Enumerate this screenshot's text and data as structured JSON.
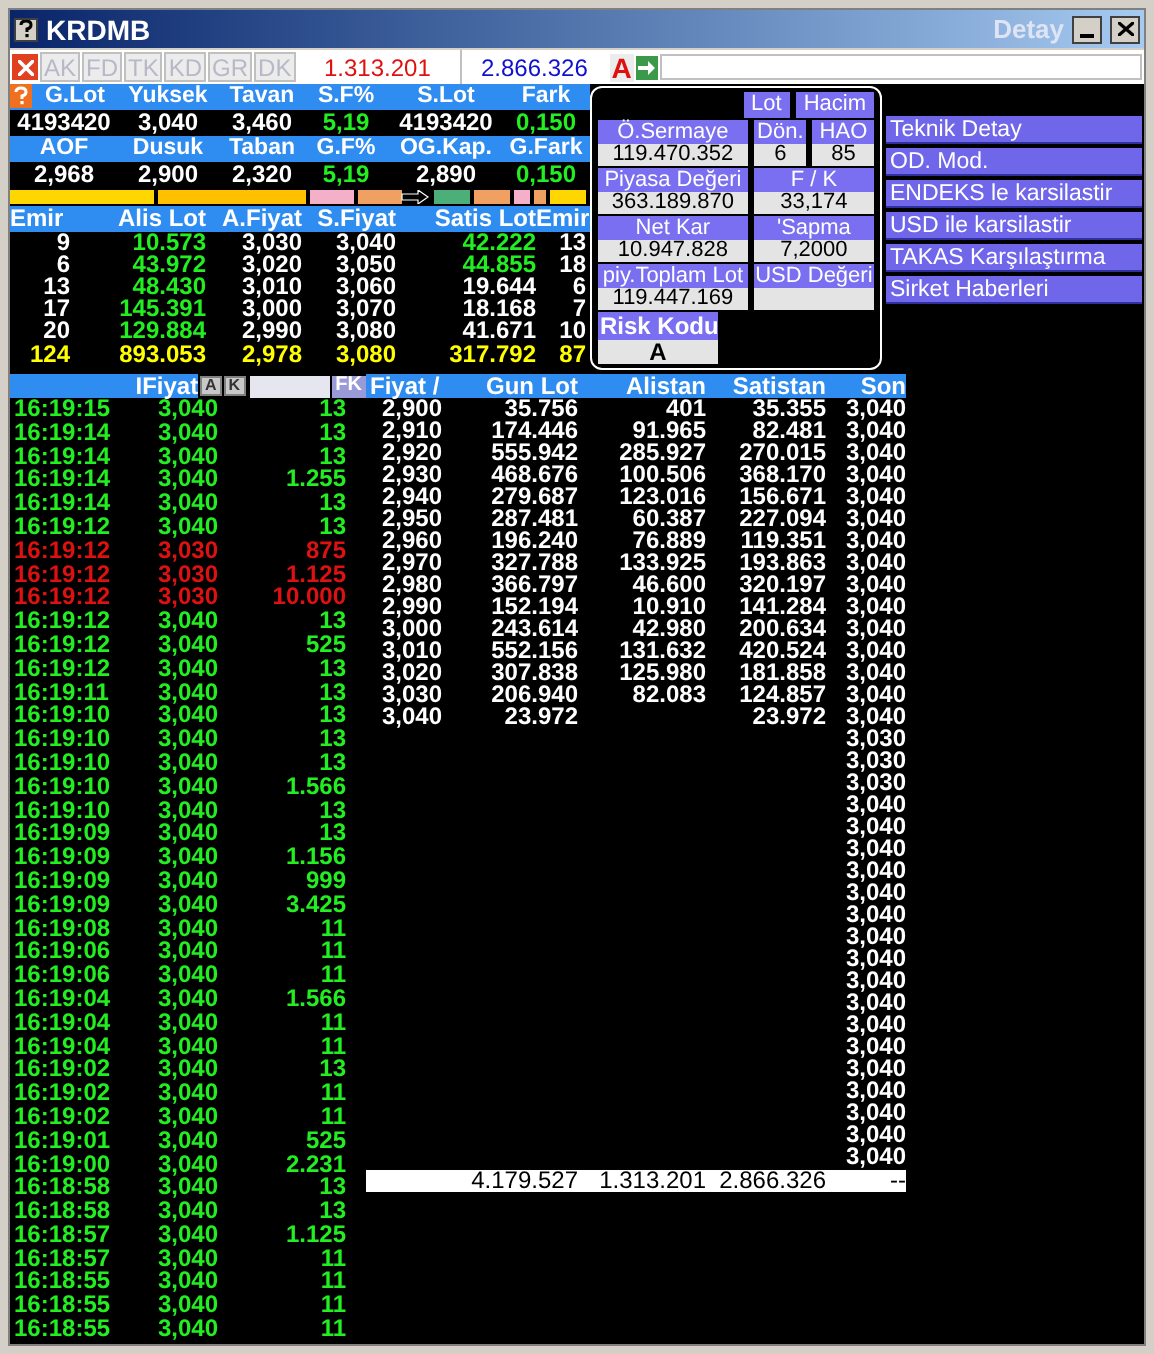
{
  "window": {
    "title": "KRDMB",
    "title_right": "Detay"
  },
  "toolbar": {
    "buttons": [
      "AK",
      "FD",
      "TK",
      "KD",
      "GR",
      "DK"
    ],
    "buy_total": "1.313.201",
    "sell_total": "2.866.326",
    "grade": "A"
  },
  "summary": [
    {
      "headers": [
        "G.Lot",
        "Yuksek",
        "Tavan",
        "S.F%",
        "S.Lot",
        "Fark"
      ],
      "values": [
        {
          "text": "4193420",
          "up": false
        },
        {
          "text": "3,040",
          "up": false
        },
        {
          "text": "3,460",
          "up": false
        },
        {
          "text": "5,19",
          "up": true
        },
        {
          "text": "4193420",
          "up": false
        },
        {
          "text": "0,150",
          "up": true
        }
      ]
    },
    {
      "headers": [
        "AOF",
        "Dusuk",
        "Taban",
        "G.F%",
        "OG.Kap.",
        "G.Fark"
      ],
      "values": [
        {
          "text": "2,968",
          "up": false
        },
        {
          "text": "2,900",
          "up": false
        },
        {
          "text": "2,320",
          "up": false
        },
        {
          "text": "5,19",
          "up": true
        },
        {
          "text": "2,890",
          "up": false
        },
        {
          "text": "0,150",
          "up": true
        }
      ]
    }
  ],
  "order_book": {
    "columns": [
      "Emir",
      "Alis Lot",
      "A.Fiyat",
      "S.Fiyat",
      "Satis Lot",
      "Emir"
    ],
    "rows": [
      {
        "cells": [
          "9",
          "10.573",
          "3,030",
          "3,040",
          "42.222",
          "13"
        ],
        "bid_up": true,
        "ask_up": true
      },
      {
        "cells": [
          "6",
          "43.972",
          "3,020",
          "3,050",
          "44.855",
          "18"
        ],
        "bid_up": true,
        "ask_up": true
      },
      {
        "cells": [
          "13",
          "48.430",
          "3,010",
          "3,060",
          "19.644",
          "6"
        ],
        "bid_up": true,
        "ask_up": false
      },
      {
        "cells": [
          "17",
          "145.391",
          "3,000",
          "3,070",
          "18.168",
          "7"
        ],
        "bid_up": true,
        "ask_up": false
      },
      {
        "cells": [
          "20",
          "129.884",
          "2,990",
          "3,080",
          "41.671",
          "10"
        ],
        "bid_up": true,
        "ask_up": false
      }
    ],
    "totals": [
      "124",
      "893.053",
      "2,978",
      "3,080",
      "317.792",
      "87"
    ]
  },
  "detail": {
    "toggles": [
      "Lot",
      "Hacim"
    ],
    "fields": [
      {
        "label": "Ö.Sermaye",
        "value": "119.470.352"
      },
      {
        "label": "Dön.",
        "value": "6"
      },
      {
        "label": "HAO",
        "value": "85"
      },
      {
        "label": "Piyasa Değeri",
        "value": "363.189.870"
      },
      {
        "label": "F / K",
        "value": "33,174"
      },
      {
        "label": "Net Kar",
        "value": "10.947.828"
      },
      {
        "label": "'Sapma",
        "value": "7,2000"
      },
      {
        "label": "piy.Toplam Lot",
        "value": "119.447.169"
      },
      {
        "label": "USD Değeri"
      }
    ],
    "risk_label": "Risk Kodu",
    "risk_value": "A"
  },
  "links": [
    "Teknik Detay",
    "OD. Mod.",
    "ENDEKS le karsilastir",
    "USD ile karsilastir",
    "TAKAS Karşılaştırma",
    "Sirket Haberleri"
  ],
  "trades": {
    "header": "IFiyat",
    "buttons": [
      "A",
      "K"
    ],
    "filter_button": "FK",
    "rows": [
      {
        "time": "16:19:15",
        "price": "3,040",
        "lot": "13",
        "sell": false
      },
      {
        "time": "16:19:14",
        "price": "3,040",
        "lot": "13",
        "sell": false
      },
      {
        "time": "16:19:14",
        "price": "3,040",
        "lot": "13",
        "sell": false
      },
      {
        "time": "16:19:14",
        "price": "3,040",
        "lot": "1.255",
        "sell": false
      },
      {
        "time": "16:19:14",
        "price": "3,040",
        "lot": "13",
        "sell": false
      },
      {
        "time": "16:19:12",
        "price": "3,040",
        "lot": "13",
        "sell": false
      },
      {
        "time": "16:19:12",
        "price": "3,030",
        "lot": "875",
        "sell": true
      },
      {
        "time": "16:19:12",
        "price": "3,030",
        "lot": "1.125",
        "sell": true
      },
      {
        "time": "16:19:12",
        "price": "3,030",
        "lot": "10.000",
        "sell": true
      },
      {
        "time": "16:19:12",
        "price": "3,040",
        "lot": "13",
        "sell": false
      },
      {
        "time": "16:19:12",
        "price": "3,040",
        "lot": "525",
        "sell": false
      },
      {
        "time": "16:19:12",
        "price": "3,040",
        "lot": "13",
        "sell": false
      },
      {
        "time": "16:19:11",
        "price": "3,040",
        "lot": "13",
        "sell": false
      },
      {
        "time": "16:19:10",
        "price": "3,040",
        "lot": "13",
        "sell": false
      },
      {
        "time": "16:19:10",
        "price": "3,040",
        "lot": "13",
        "sell": false
      },
      {
        "time": "16:19:10",
        "price": "3,040",
        "lot": "13",
        "sell": false
      },
      {
        "time": "16:19:10",
        "price": "3,040",
        "lot": "1.566",
        "sell": false
      },
      {
        "time": "16:19:10",
        "price": "3,040",
        "lot": "13",
        "sell": false
      },
      {
        "time": "16:19:09",
        "price": "3,040",
        "lot": "13",
        "sell": false
      },
      {
        "time": "16:19:09",
        "price": "3,040",
        "lot": "1.156",
        "sell": false
      },
      {
        "time": "16:19:09",
        "price": "3,040",
        "lot": "999",
        "sell": false
      },
      {
        "time": "16:19:09",
        "price": "3,040",
        "lot": "3.425",
        "sell": false
      },
      {
        "time": "16:19:08",
        "price": "3,040",
        "lot": "11",
        "sell": false
      },
      {
        "time": "16:19:06",
        "price": "3,040",
        "lot": "11",
        "sell": false
      },
      {
        "time": "16:19:06",
        "price": "3,040",
        "lot": "11",
        "sell": false
      },
      {
        "time": "16:19:04",
        "price": "3,040",
        "lot": "1.566",
        "sell": false
      },
      {
        "time": "16:19:04",
        "price": "3,040",
        "lot": "11",
        "sell": false
      },
      {
        "time": "16:19:04",
        "price": "3,040",
        "lot": "11",
        "sell": false
      },
      {
        "time": "16:19:02",
        "price": "3,040",
        "lot": "13",
        "sell": false
      },
      {
        "time": "16:19:02",
        "price": "3,040",
        "lot": "11",
        "sell": false
      },
      {
        "time": "16:19:02",
        "price": "3,040",
        "lot": "11",
        "sell": false
      },
      {
        "time": "16:19:01",
        "price": "3,040",
        "lot": "525",
        "sell": false
      },
      {
        "time": "16:19:00",
        "price": "3,040",
        "lot": "2.231",
        "sell": false
      },
      {
        "time": "16:18:58",
        "price": "3,040",
        "lot": "13",
        "sell": false
      },
      {
        "time": "16:18:58",
        "price": "3,040",
        "lot": "13",
        "sell": false
      },
      {
        "time": "16:18:57",
        "price": "3,040",
        "lot": "1.125",
        "sell": false
      },
      {
        "time": "16:18:57",
        "price": "3,040",
        "lot": "11",
        "sell": false
      },
      {
        "time": "16:18:55",
        "price": "3,040",
        "lot": "11",
        "sell": false
      },
      {
        "time": "16:18:55",
        "price": "3,040",
        "lot": "11",
        "sell": false
      },
      {
        "time": "16:18:55",
        "price": "3,040",
        "lot": "11",
        "sell": false
      }
    ]
  },
  "price_table": {
    "columns": [
      "Fiyat /",
      "Gun Lot",
      "Alistan",
      "Satistan",
      "Son"
    ],
    "rows": [
      [
        "2,900",
        "35.756",
        "401",
        "35.355"
      ],
      [
        "2,910",
        "174.446",
        "91.965",
        "82.481"
      ],
      [
        "2,920",
        "555.942",
        "285.927",
        "270.015"
      ],
      [
        "2,930",
        "468.676",
        "100.506",
        "368.170"
      ],
      [
        "2,940",
        "279.687",
        "123.016",
        "156.671"
      ],
      [
        "2,950",
        "287.481",
        "60.387",
        "227.094"
      ],
      [
        "2,960",
        "196.240",
        "76.889",
        "119.351"
      ],
      [
        "2,970",
        "327.788",
        "133.925",
        "193.863"
      ],
      [
        "2,980",
        "366.797",
        "46.600",
        "320.197"
      ],
      [
        "2,990",
        "152.194",
        "10.910",
        "141.284"
      ],
      [
        "3,000",
        "243.614",
        "42.980",
        "200.634"
      ],
      [
        "3,010",
        "552.156",
        "131.632",
        "420.524"
      ],
      [
        "3,020",
        "307.838",
        "125.980",
        "181.858"
      ],
      [
        "3,030",
        "206.940",
        "82.083",
        "124.857"
      ],
      [
        "3,040",
        "23.972",
        "",
        "23.972"
      ]
    ],
    "son": [
      "3,040",
      "3,040",
      "3,040",
      "3,040",
      "3,040",
      "3,040",
      "3,040",
      "3,040",
      "3,040",
      "3,040",
      "3,040",
      "3,040",
      "3,040",
      "3,040",
      "3,040",
      "3,030",
      "3,030",
      "3,030",
      "3,040",
      "3,040",
      "3,040",
      "3,040",
      "3,040",
      "3,040",
      "3,040",
      "3,040",
      "3,040",
      "3,040",
      "3,040",
      "3,040",
      "3,040",
      "3,040",
      "3,040",
      "3,040",
      "3,040"
    ],
    "totals": [
      "4.179.527",
      "1.313.201",
      "2.866.326",
      "--"
    ]
  }
}
